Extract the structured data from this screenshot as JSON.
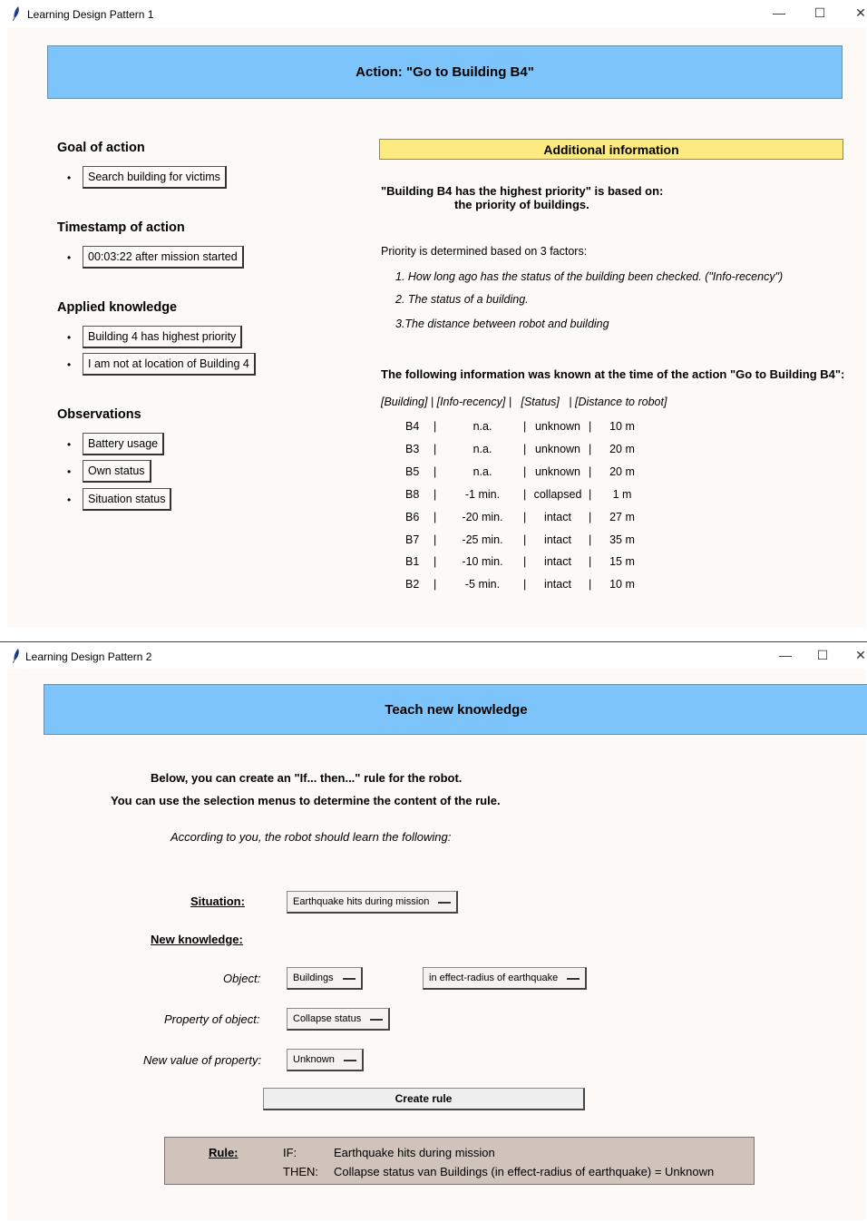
{
  "window1": {
    "title": "Learning Design Pattern 1",
    "banner": "Action: \"Go to Building B4\"",
    "goal": {
      "heading": "Goal of action",
      "items": [
        "Search building for victims"
      ]
    },
    "timestamp": {
      "heading": "Timestamp of action",
      "items": [
        "00:03:22 after mission started"
      ]
    },
    "knowledge": {
      "heading": "Applied knowledge",
      "items": [
        "Building 4 has highest priority",
        "I am not at location of Building 4"
      ]
    },
    "observations": {
      "heading": "Observations",
      "items": [
        "Battery usage",
        "Own status",
        "Situation status"
      ]
    },
    "bullet": "•",
    "additional": {
      "heading": "Additional information",
      "based_line1": "\"Building B4 has the highest priority\" is based on:",
      "based_line2": "the priority of buildings.",
      "factors_intro": "Priority is determined based on 3 factors:",
      "factors": [
        "1. How long ago has the status of the building been checked. (\"Info-recency\")",
        "2. The status of a building.",
        "3.The distance between robot and building"
      ],
      "known_heading": "The following information was known at the time of the action \"Go to Building B4\":",
      "table_header": "[Building] | [Info-recency] |   [Status]   | [Distance to robot]",
      "sep": "|",
      "rows": [
        {
          "building": "B4",
          "recency": "n.a.",
          "status": "unknown",
          "distance": "10 m"
        },
        {
          "building": "B3",
          "recency": "n.a.",
          "status": "unknown",
          "distance": "20 m"
        },
        {
          "building": "B5",
          "recency": "n.a.",
          "status": "unknown",
          "distance": "20 m"
        },
        {
          "building": "B8",
          "recency": "-1 min.",
          "status": "collapsed",
          "distance": "1 m"
        },
        {
          "building": "B6",
          "recency": "-20 min.",
          "status": "intact",
          "distance": "27 m"
        },
        {
          "building": "B7",
          "recency": "-25 min.",
          "status": "intact",
          "distance": "35 m"
        },
        {
          "building": "B1",
          "recency": "-10 min.",
          "status": "intact",
          "distance": "15 m"
        },
        {
          "building": "B2",
          "recency": "-5 min.",
          "status": "intact",
          "distance": "10 m"
        }
      ]
    }
  },
  "window2": {
    "title": "Learning Design Pattern 2",
    "banner": "Teach new knowledge",
    "intro1": "Below, you can create an \"If... then...\" rule for the robot.",
    "intro2": "You can use the selection menus to determine the content of the rule.",
    "intro3": "According to you, the robot should learn the following:",
    "situation_label": "Situation:",
    "situation_value": "Earthquake hits during mission",
    "new_knowledge_label": "New knowledge:",
    "object_label": "Object:",
    "object_value": "Buildings",
    "object_filter_value": "in effect-radius of earthquake",
    "property_label": "Property of object:",
    "property_value": "Collapse status",
    "newvalue_label": "New value of property:",
    "newvalue_value": "Unknown",
    "create_button": "Create rule",
    "rule": {
      "label": "Rule:",
      "if_label": "IF:",
      "if_text": "Earthquake hits during mission",
      "then_label": "THEN:",
      "then_text": "Collapse status van Buildings (in effect-radius of earthquake) = Unknown"
    }
  },
  "window_controls": {
    "minimize": "—",
    "maximize": "☐",
    "close": "✕"
  }
}
